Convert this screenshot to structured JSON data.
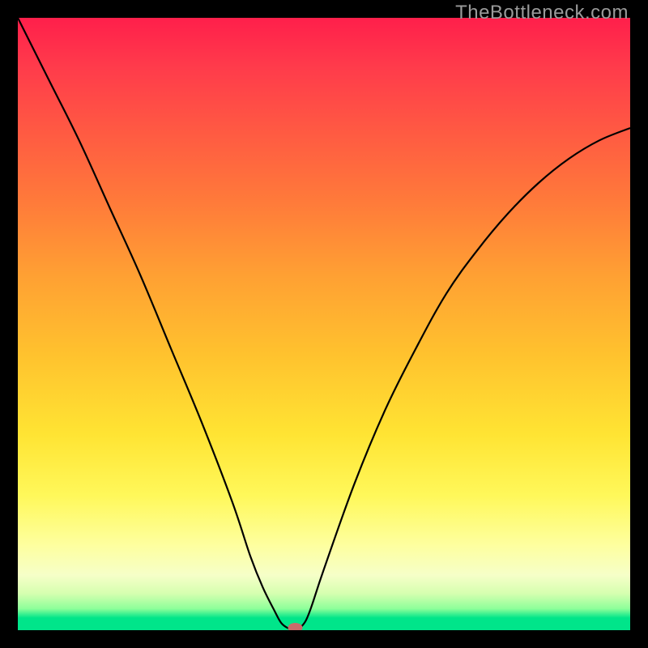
{
  "watermark": "TheBottleneck.com",
  "colors": {
    "frame": "#000000",
    "curve": "#000000",
    "marker": "#c96a6a",
    "gradient_top": "#ff1f4b",
    "gradient_mid": "#ffe433",
    "gradient_bottom": "#00e58a"
  },
  "chart_data": {
    "type": "line",
    "title": "",
    "xlabel": "",
    "ylabel": "",
    "xlim": [
      0,
      100
    ],
    "ylim": [
      0,
      100
    ],
    "grid": false,
    "x": [
      0,
      5,
      10,
      15,
      20,
      25,
      30,
      35,
      38,
      40,
      42,
      43,
      44,
      45,
      45.5,
      46,
      47,
      48,
      50,
      55,
      60,
      65,
      70,
      75,
      80,
      85,
      90,
      95,
      100
    ],
    "values": [
      100,
      90,
      80,
      69,
      58,
      46,
      34,
      21,
      12,
      7,
      3,
      1.2,
      0.4,
      0,
      0,
      0.3,
      1.5,
      4,
      10,
      24,
      36,
      46,
      55,
      62,
      68,
      73,
      77,
      80,
      82
    ],
    "marker": {
      "x": 45.3,
      "y": 0
    },
    "notes": "V-shaped bottleneck curve; minimum (optimal match) near x≈45 where bottleneck≈0%. Values are read off the vertical gradient where 0 is the green baseline and 100 is the top edge."
  }
}
